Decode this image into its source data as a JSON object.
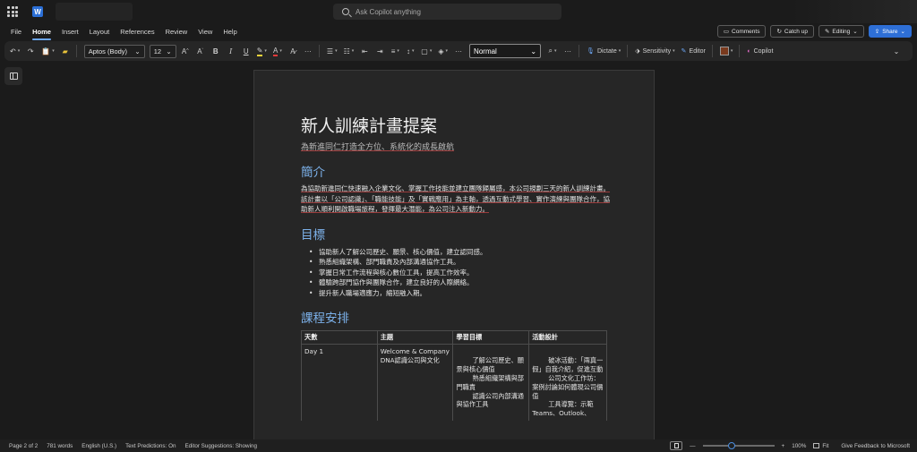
{
  "app": {
    "search_placeholder": "Ask Copilot anything",
    "word_icon_letter": "W"
  },
  "menu": {
    "items": [
      "File",
      "Home",
      "Insert",
      "Layout",
      "References",
      "Review",
      "View",
      "Help"
    ],
    "active": "Home"
  },
  "header_buttons": {
    "comments": "Comments",
    "catch_up": "Catch up",
    "editing": "Editing",
    "share": "Share"
  },
  "toolbar": {
    "font_name": "Aptos (Body)",
    "font_size": "12",
    "style": "Normal",
    "dictate": "Dictate",
    "sensitivity": "Sensitivity",
    "editor": "Editor",
    "copilot": "Copilot",
    "highlight_color": "#f2d33a",
    "font_color": "#e23b3b",
    "shading_color": "#7a3a1e"
  },
  "document": {
    "title": "新人訓練計畫提案",
    "subtitle": "為新進同仁打造全方位、系統化的成長啟航",
    "intro_heading": "簡介",
    "intro_text": "為協助新進同仁快速融入企業文化、掌握工作技能並建立團隊歸屬感，本公司規劃三天的新人訓練計畫。該計畫以「公司認識」、「職能技能」及「實戰應用」為主軸，透過互動式學習、實作演練與團隊合作，協助新人順利開啟職場旅程，發揮最大潛能，為公司注入新動力。",
    "goals_heading": "目標",
    "goals": [
      "協助新人了解公司歷史、願景、核心價值，建立認同感。",
      "熟悉組織架構、部門職責及內部溝通協作工具。",
      "掌握日常工作流程與核心數位工具，提高工作效率。",
      "體驗跨部門協作與團隊合作，建立良好的人際網絡。",
      "提升新人職場適應力，縮短融入期。"
    ],
    "schedule_heading": "課程安排",
    "schedule": {
      "headers": [
        "天數",
        "主題",
        "學習目標",
        "活動設計"
      ],
      "row1": {
        "day": "Day 1",
        "topic": "Welcome & Company DNA認識公司與文化",
        "goals": [
          "了解公司歷史、願景與核心價值",
          "熟悉組織架構與部門職責",
          "認識公司內部溝通與協作工具"
        ],
        "activities": [
          "破冰活動：「兩真一假」自我介紹，促進互動",
          "公司文化工作坊：案例討論如何體現公司價值",
          "工具導覽：示範Teams、Outlook、"
        ]
      }
    }
  },
  "status": {
    "page": "Page 2 of 2",
    "words": "781 words",
    "language": "English (U.S.)",
    "text_predictions": "Text Predictions: On",
    "editor_suggestions": "Editor Suggestions: Showing",
    "zoom_minus": "—",
    "zoom_plus": "+",
    "zoom_level": "100%",
    "fit": "Fit",
    "feedback": "Give Feedback to Microsoft",
    "zoom_fraction": 0.4
  }
}
